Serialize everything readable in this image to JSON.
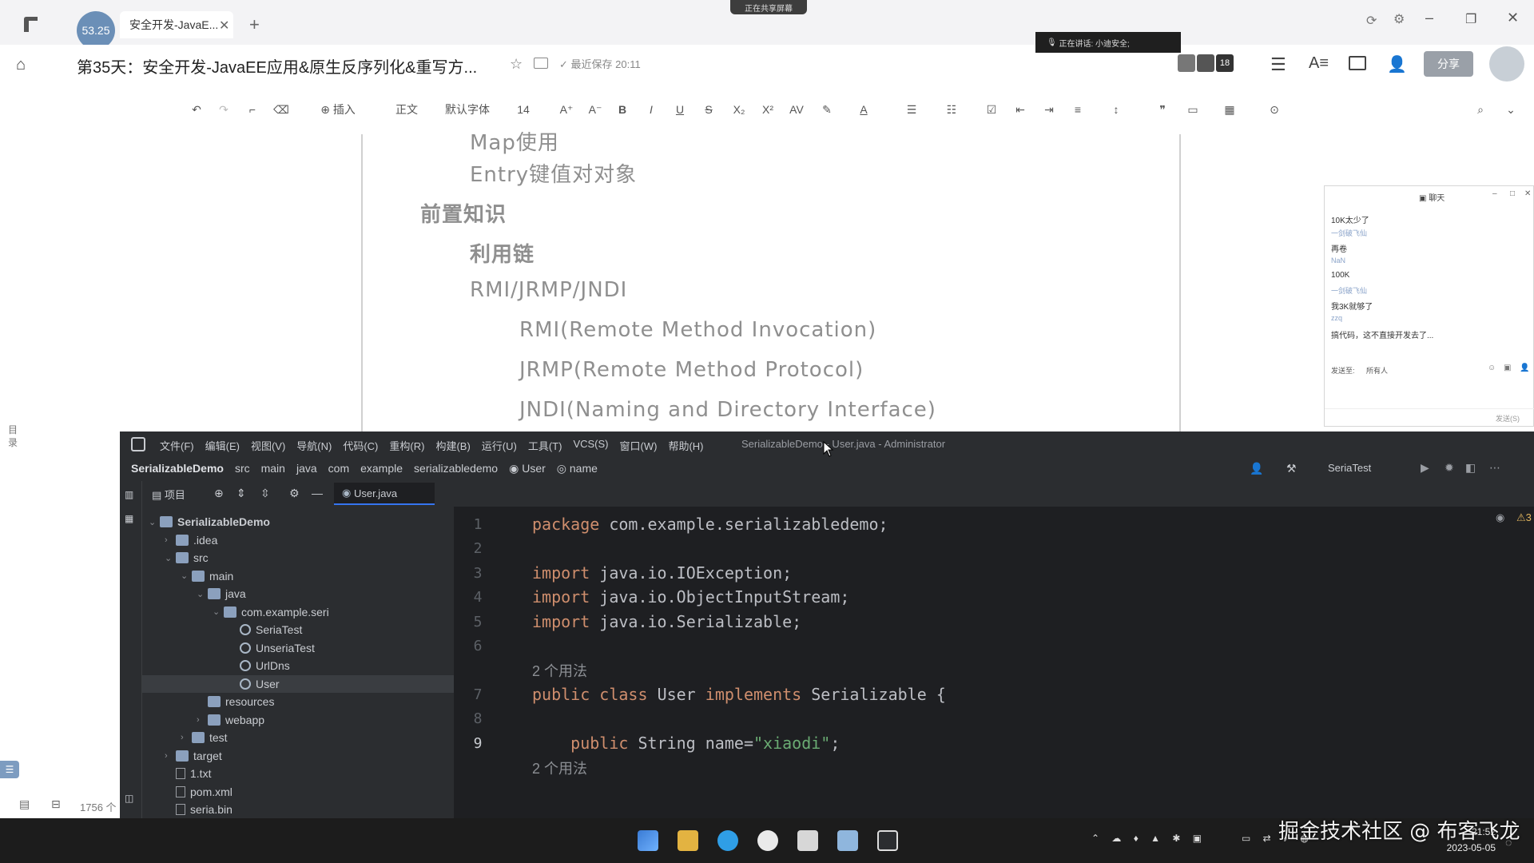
{
  "browser": {
    "tab_title": "安全开发-JavaE...",
    "tab_badge": "53.25",
    "sharing_banner": "正在共享屏幕",
    "speaking_banner": "正在讲话: 小迪安全;"
  },
  "document": {
    "title": "第35天：安全开发-JavaEE应用&原生反序列化&重写方...",
    "save_status": "最近保存 20:11",
    "member_count": "18",
    "share_label": "分享",
    "toolbar": {
      "insert": "插入",
      "style": "正文",
      "font": "默认字体",
      "size": "14"
    },
    "outline_label": "目录",
    "word_count": "1756 个",
    "lines": [
      {
        "text": "Map使用",
        "indent": 1,
        "bold": false
      },
      {
        "text": "Entry键值对对象",
        "indent": 1,
        "bold": false
      },
      {
        "text": "前置知识",
        "indent": 0,
        "bold": true
      },
      {
        "text": "利用链",
        "indent": 1,
        "bold": true
      },
      {
        "text": "RMI/JRMP/JNDI",
        "indent": 1,
        "bold": false
      },
      {
        "text": "RMI(Remote Method Invocation)",
        "indent": 2,
        "bold": false
      },
      {
        "text": "JRMP(Remote Method Protocol)",
        "indent": 2,
        "bold": false
      },
      {
        "text": "JNDI(Naming and Directory Interface)",
        "indent": 2,
        "bold": false
      }
    ]
  },
  "chat": {
    "title": "聊天",
    "messages": [
      {
        "name": "NaN",
        "text": "10K太少了"
      },
      {
        "name": "一剑破飞仙",
        "text": "再卷"
      },
      {
        "name": "NaN",
        "text": "100K"
      },
      {
        "name": "一剑破飞仙",
        "text": "我3K就够了"
      },
      {
        "name": "zzq",
        "text": "搞代码，这不直接开发去了..."
      }
    ],
    "send_to_label": "发送至:",
    "send_to_value": "所有人",
    "send_button": "发送(S)"
  },
  "ide": {
    "menu": [
      "文件(F)",
      "编辑(E)",
      "视图(V)",
      "导航(N)",
      "代码(C)",
      "重构(R)",
      "构建(B)",
      "运行(U)",
      "工具(T)",
      "VCS(S)",
      "窗口(W)",
      "帮助(H)"
    ],
    "window_title": "SerializableDemo - User.java - Administrator",
    "breadcrumb": [
      "SerializableDemo",
      "src",
      "main",
      "java",
      "com",
      "example",
      "serializabledemo",
      "User",
      "name"
    ],
    "run_config": "SeriaTest",
    "project_label": "项目",
    "tab": "User.java",
    "inspections": {
      "warnings": "3",
      "ok": "1"
    },
    "tree": [
      {
        "label": "SerializableDemo",
        "depth": 0,
        "kind": "project",
        "arrow": "down"
      },
      {
        "label": ".idea",
        "depth": 1,
        "kind": "folder",
        "arrow": "right"
      },
      {
        "label": "src",
        "depth": 1,
        "kind": "folder",
        "arrow": "down"
      },
      {
        "label": "main",
        "depth": 2,
        "kind": "folder",
        "arrow": "down"
      },
      {
        "label": "java",
        "depth": 3,
        "kind": "folder",
        "arrow": "down"
      },
      {
        "label": "com.example.seri",
        "depth": 4,
        "kind": "package",
        "arrow": "down"
      },
      {
        "label": "SeriaTest",
        "depth": 5,
        "kind": "class",
        "arrow": ""
      },
      {
        "label": "UnseriaTest",
        "depth": 5,
        "kind": "class",
        "arrow": ""
      },
      {
        "label": "UrlDns",
        "depth": 5,
        "kind": "class",
        "arrow": ""
      },
      {
        "label": "User",
        "depth": 5,
        "kind": "class",
        "arrow": "",
        "selected": true
      },
      {
        "label": "resources",
        "depth": 3,
        "kind": "folder",
        "arrow": ""
      },
      {
        "label": "webapp",
        "depth": 3,
        "kind": "folder",
        "arrow": "right"
      },
      {
        "label": "test",
        "depth": 2,
        "kind": "folder",
        "arrow": "right"
      },
      {
        "label": "target",
        "depth": 1,
        "kind": "folder",
        "arrow": "right"
      },
      {
        "label": "1.txt",
        "depth": 1,
        "kind": "file",
        "arrow": ""
      },
      {
        "label": "pom.xml",
        "depth": 1,
        "kind": "file",
        "arrow": ""
      },
      {
        "label": "seria.bin",
        "depth": 1,
        "kind": "file",
        "arrow": ""
      }
    ],
    "code": [
      {
        "n": "1",
        "t": "package com.example.serializabledemo;"
      },
      {
        "n": "2",
        "t": ""
      },
      {
        "n": "3",
        "t": "import java.io.IOException;"
      },
      {
        "n": "4",
        "t": "import java.io.ObjectInputStream;"
      },
      {
        "n": "5",
        "t": "import java.io.Serializable;"
      },
      {
        "n": "6",
        "t": ""
      },
      {
        "n": "",
        "t": "2 个用法",
        "hint": true
      },
      {
        "n": "7",
        "t": "public class User implements Serializable {"
      },
      {
        "n": "8",
        "t": ""
      },
      {
        "n": "9",
        "t": "    public String name=\"xiaodi\";"
      },
      {
        "n": "",
        "t": "2 个用法",
        "hint": true
      }
    ]
  },
  "taskbar": {
    "time": "21:52",
    "date": "2023-05-05"
  },
  "watermark": "掘金技术社区 @ 布客飞龙",
  "colors": {
    "accent_blue": "#4a7cf6",
    "ide_bg": "#2b2d30",
    "editor_bg": "#1e1f22",
    "taskbar_bg": "#1c1c1c"
  }
}
